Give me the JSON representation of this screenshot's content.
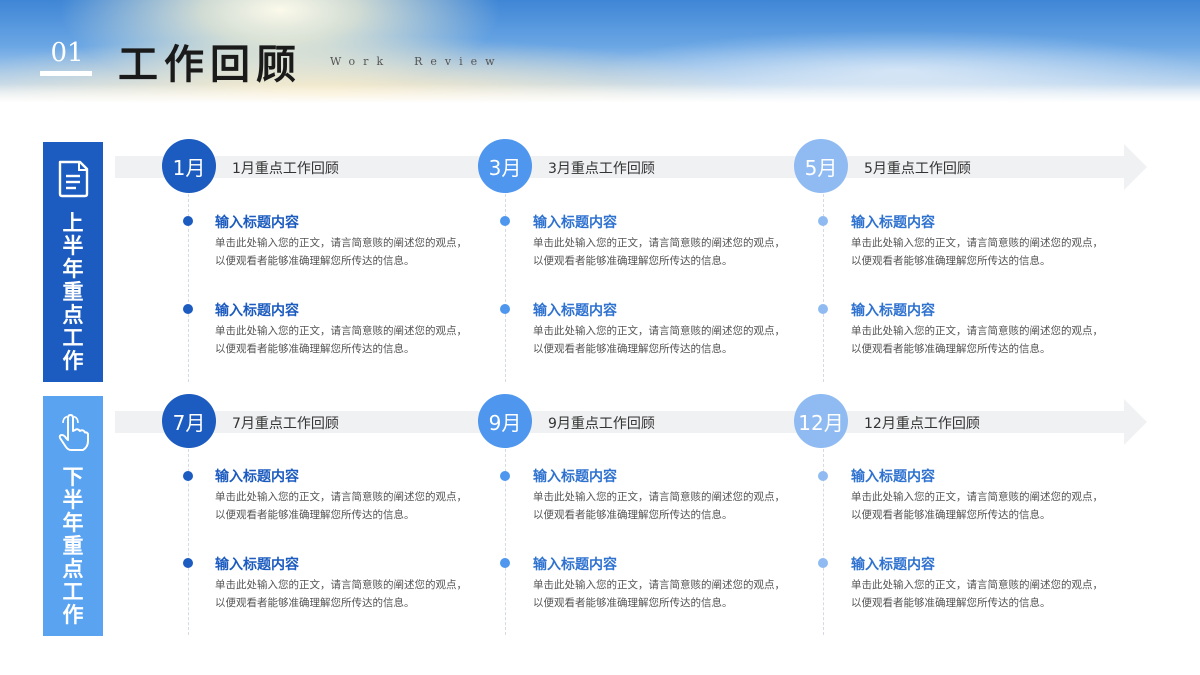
{
  "header": {
    "number": "01",
    "title": "工作回顾",
    "subtitle": "Work  Review"
  },
  "colors": {
    "dark_blue": "#1c5bbf",
    "mid_blue": "#4e96ee",
    "light_blue": "#8fbbf2",
    "side_bottom": "#5aa3f0",
    "arrow": "#f0f1f3"
  },
  "sections": [
    {
      "label": "上半年重点工作",
      "icon": "document-icon",
      "months": [
        {
          "badge": "1月",
          "title": "1月重点工作回顾",
          "items": [
            {
              "title": "输入标题内容",
              "body": "单击此处输入您的正文，请言简意赅的阐述您的观点，以便观看者能够准确理解您所传达的信息。"
            },
            {
              "title": "输入标题内容",
              "body": "单击此处输入您的正文，请言简意赅的阐述您的观点，以便观看者能够准确理解您所传达的信息。"
            }
          ]
        },
        {
          "badge": "3月",
          "title": "3月重点工作回顾",
          "items": [
            {
              "title": "输入标题内容",
              "body": "单击此处输入您的正文，请言简意赅的阐述您的观点，以便观看者能够准确理解您所传达的信息。"
            },
            {
              "title": "输入标题内容",
              "body": "单击此处输入您的正文，请言简意赅的阐述您的观点，以便观看者能够准确理解您所传达的信息。"
            }
          ]
        },
        {
          "badge": "5月",
          "title": "5月重点工作回顾",
          "items": [
            {
              "title": "输入标题内容",
              "body": "单击此处输入您的正文，请言简意赅的阐述您的观点，以便观看者能够准确理解您所传达的信息。"
            },
            {
              "title": "输入标题内容",
              "body": "单击此处输入您的正文，请言简意赅的阐述您的观点，以便观看者能够准确理解您所传达的信息。"
            }
          ]
        }
      ]
    },
    {
      "label": "下半年重点工作",
      "icon": "hand-pointer-icon",
      "months": [
        {
          "badge": "7月",
          "title": "7月重点工作回顾",
          "items": [
            {
              "title": "输入标题内容",
              "body": "单击此处输入您的正文，请言简意赅的阐述您的观点，以便观看者能够准确理解您所传达的信息。"
            },
            {
              "title": "输入标题内容",
              "body": "单击此处输入您的正文，请言简意赅的阐述您的观点，以便观看者能够准确理解您所传达的信息。"
            }
          ]
        },
        {
          "badge": "9月",
          "title": "9月重点工作回顾",
          "items": [
            {
              "title": "输入标题内容",
              "body": "单击此处输入您的正文，请言简意赅的阐述您的观点，以便观看者能够准确理解您所传达的信息。"
            },
            {
              "title": "输入标题内容",
              "body": "单击此处输入您的正文，请言简意赅的阐述您的观点，以便观看者能够准确理解您所传达的信息。"
            }
          ]
        },
        {
          "badge": "12月",
          "title": "12月重点工作回顾",
          "items": [
            {
              "title": "输入标题内容",
              "body": "单击此处输入您的正文，请言简意赅的阐述您的观点，以便观看者能够准确理解您所传达的信息。"
            },
            {
              "title": "输入标题内容",
              "body": "单击此处输入您的正文，请言简意赅的阐述您的观点，以便观看者能够准确理解您所传达的信息。"
            }
          ]
        }
      ]
    }
  ]
}
